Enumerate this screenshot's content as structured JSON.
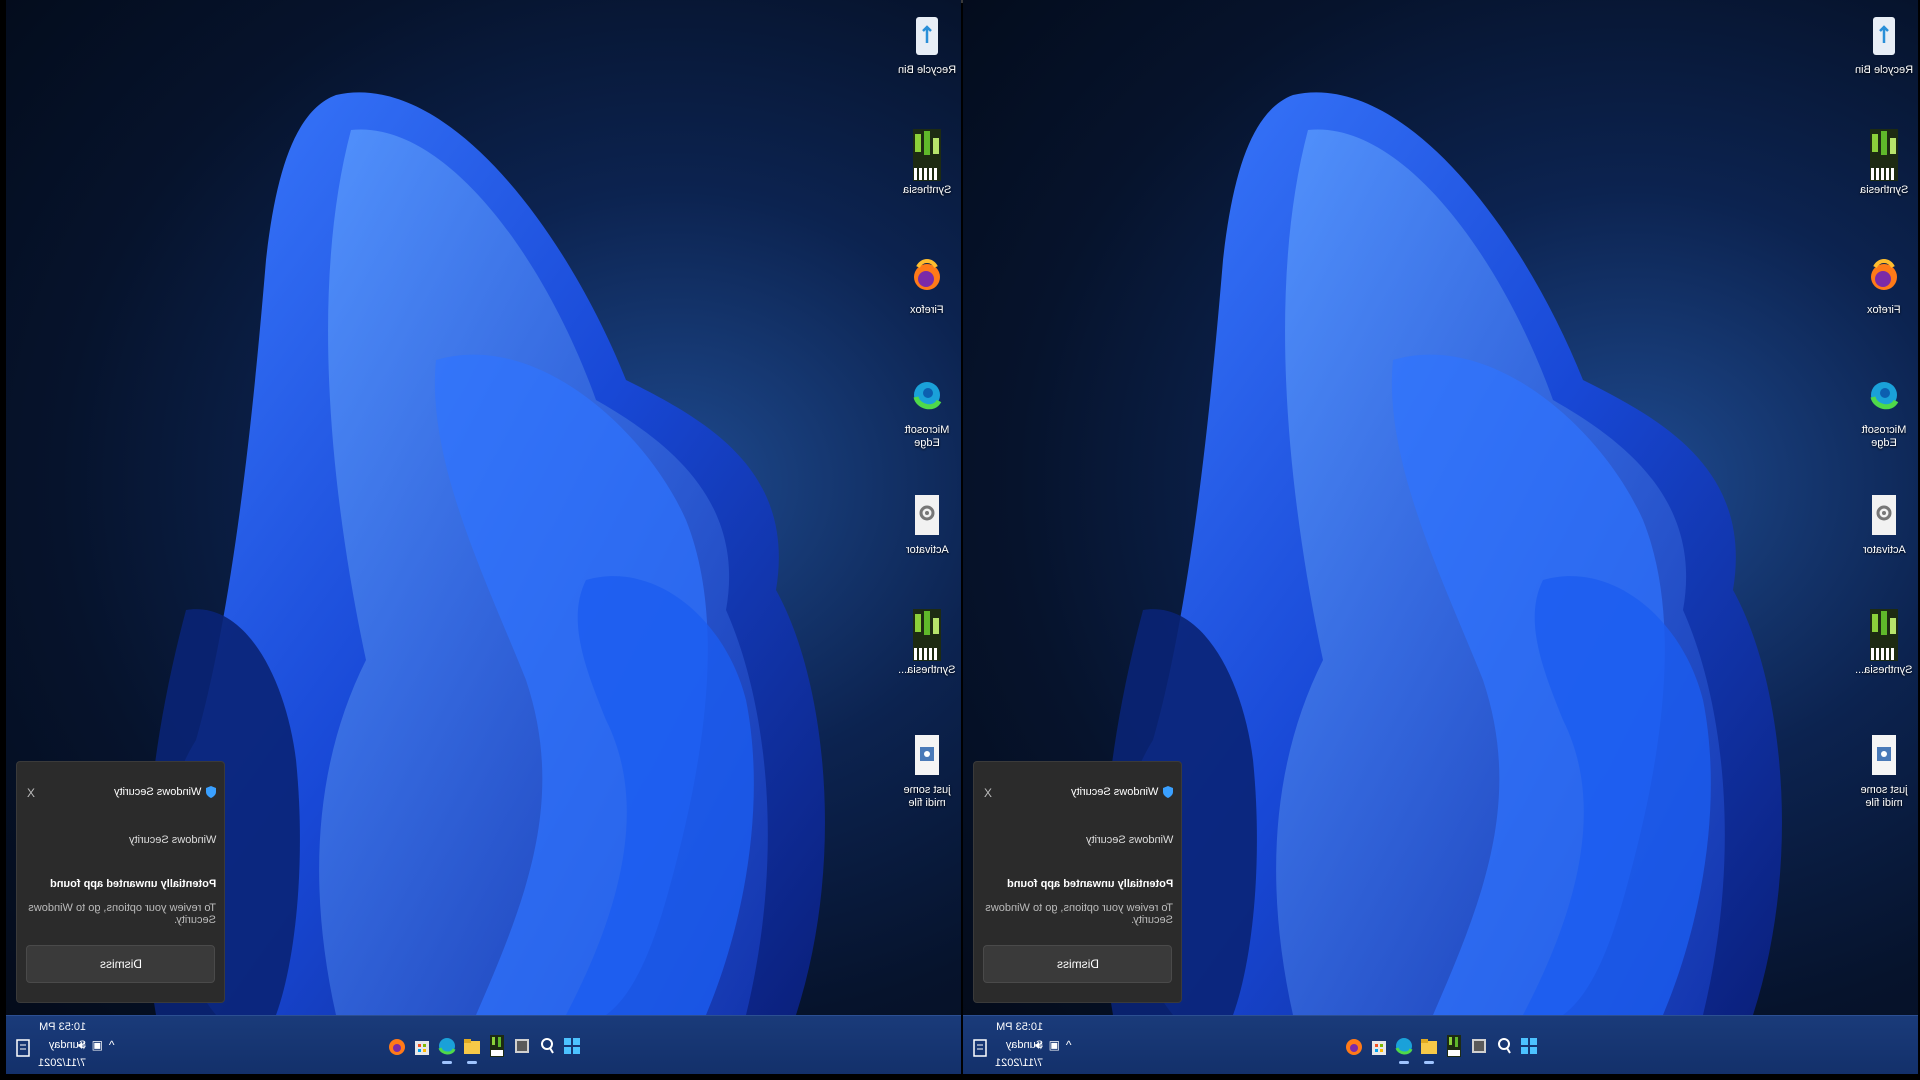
{
  "desktop_icons": [
    {
      "label": "Recycle Bin",
      "icon": "recycle-bin-icon"
    },
    {
      "label": "Synthesia",
      "icon": "synthesia-icon"
    },
    {
      "label": "Firefox",
      "icon": "firefox-icon"
    },
    {
      "label": "Microsoft Edge",
      "icon": "edge-icon"
    },
    {
      "label": "Activator",
      "icon": "settings-file-icon"
    },
    {
      "label": "Synthesia...",
      "icon": "synthesia-icon"
    },
    {
      "label": "just some midi file",
      "icon": "midi-file-icon"
    }
  ],
  "toast": {
    "close": "X",
    "app_name": "Windows Security",
    "source": "Windows Security",
    "headline": "Potentially unwanted app found",
    "body": "To review your options, go to Windows Security.",
    "button": "Dismiss"
  },
  "taskbar": {
    "time": "10:53 PM",
    "day": "Sunday",
    "date": "7/11/2021",
    "tray": [
      "^",
      "speaker-icon",
      "network-icon"
    ],
    "apps": [
      "firefox-icon",
      "store-icon",
      "edge-icon",
      "file-explorer-icon",
      "synthesia-icon",
      "terminal-icon",
      "search-icon",
      "start-icon"
    ]
  },
  "colors": {
    "taskbar": "#16356f",
    "toast": "#2b2b2b",
    "wallpaper_bloom": "#1f5fe8"
  }
}
